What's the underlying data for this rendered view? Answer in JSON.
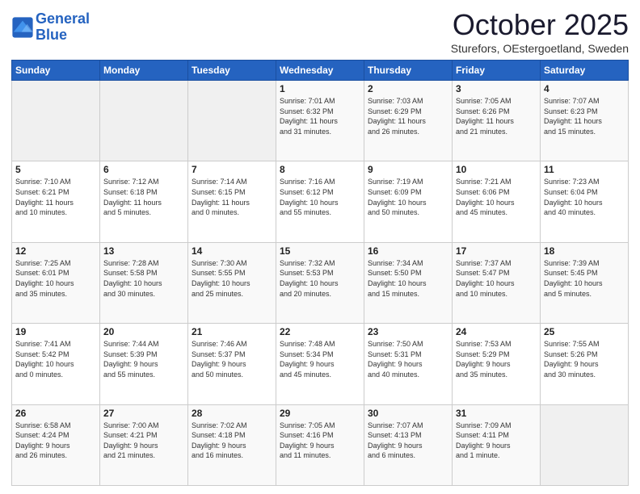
{
  "logo": {
    "line1": "General",
    "line2": "Blue"
  },
  "title": "October 2025",
  "subtitle": "Sturefors, OEstergoetland, Sweden",
  "headers": [
    "Sunday",
    "Monday",
    "Tuesday",
    "Wednesday",
    "Thursday",
    "Friday",
    "Saturday"
  ],
  "weeks": [
    [
      {
        "day": "",
        "info": ""
      },
      {
        "day": "",
        "info": ""
      },
      {
        "day": "",
        "info": ""
      },
      {
        "day": "1",
        "info": "Sunrise: 7:01 AM\nSunset: 6:32 PM\nDaylight: 11 hours\nand 31 minutes."
      },
      {
        "day": "2",
        "info": "Sunrise: 7:03 AM\nSunset: 6:29 PM\nDaylight: 11 hours\nand 26 minutes."
      },
      {
        "day": "3",
        "info": "Sunrise: 7:05 AM\nSunset: 6:26 PM\nDaylight: 11 hours\nand 21 minutes."
      },
      {
        "day": "4",
        "info": "Sunrise: 7:07 AM\nSunset: 6:23 PM\nDaylight: 11 hours\nand 15 minutes."
      }
    ],
    [
      {
        "day": "5",
        "info": "Sunrise: 7:10 AM\nSunset: 6:21 PM\nDaylight: 11 hours\nand 10 minutes."
      },
      {
        "day": "6",
        "info": "Sunrise: 7:12 AM\nSunset: 6:18 PM\nDaylight: 11 hours\nand 5 minutes."
      },
      {
        "day": "7",
        "info": "Sunrise: 7:14 AM\nSunset: 6:15 PM\nDaylight: 11 hours\nand 0 minutes."
      },
      {
        "day": "8",
        "info": "Sunrise: 7:16 AM\nSunset: 6:12 PM\nDaylight: 10 hours\nand 55 minutes."
      },
      {
        "day": "9",
        "info": "Sunrise: 7:19 AM\nSunset: 6:09 PM\nDaylight: 10 hours\nand 50 minutes."
      },
      {
        "day": "10",
        "info": "Sunrise: 7:21 AM\nSunset: 6:06 PM\nDaylight: 10 hours\nand 45 minutes."
      },
      {
        "day": "11",
        "info": "Sunrise: 7:23 AM\nSunset: 6:04 PM\nDaylight: 10 hours\nand 40 minutes."
      }
    ],
    [
      {
        "day": "12",
        "info": "Sunrise: 7:25 AM\nSunset: 6:01 PM\nDaylight: 10 hours\nand 35 minutes."
      },
      {
        "day": "13",
        "info": "Sunrise: 7:28 AM\nSunset: 5:58 PM\nDaylight: 10 hours\nand 30 minutes."
      },
      {
        "day": "14",
        "info": "Sunrise: 7:30 AM\nSunset: 5:55 PM\nDaylight: 10 hours\nand 25 minutes."
      },
      {
        "day": "15",
        "info": "Sunrise: 7:32 AM\nSunset: 5:53 PM\nDaylight: 10 hours\nand 20 minutes."
      },
      {
        "day": "16",
        "info": "Sunrise: 7:34 AM\nSunset: 5:50 PM\nDaylight: 10 hours\nand 15 minutes."
      },
      {
        "day": "17",
        "info": "Sunrise: 7:37 AM\nSunset: 5:47 PM\nDaylight: 10 hours\nand 10 minutes."
      },
      {
        "day": "18",
        "info": "Sunrise: 7:39 AM\nSunset: 5:45 PM\nDaylight: 10 hours\nand 5 minutes."
      }
    ],
    [
      {
        "day": "19",
        "info": "Sunrise: 7:41 AM\nSunset: 5:42 PM\nDaylight: 10 hours\nand 0 minutes."
      },
      {
        "day": "20",
        "info": "Sunrise: 7:44 AM\nSunset: 5:39 PM\nDaylight: 9 hours\nand 55 minutes."
      },
      {
        "day": "21",
        "info": "Sunrise: 7:46 AM\nSunset: 5:37 PM\nDaylight: 9 hours\nand 50 minutes."
      },
      {
        "day": "22",
        "info": "Sunrise: 7:48 AM\nSunset: 5:34 PM\nDaylight: 9 hours\nand 45 minutes."
      },
      {
        "day": "23",
        "info": "Sunrise: 7:50 AM\nSunset: 5:31 PM\nDaylight: 9 hours\nand 40 minutes."
      },
      {
        "day": "24",
        "info": "Sunrise: 7:53 AM\nSunset: 5:29 PM\nDaylight: 9 hours\nand 35 minutes."
      },
      {
        "day": "25",
        "info": "Sunrise: 7:55 AM\nSunset: 5:26 PM\nDaylight: 9 hours\nand 30 minutes."
      }
    ],
    [
      {
        "day": "26",
        "info": "Sunrise: 6:58 AM\nSunset: 4:24 PM\nDaylight: 9 hours\nand 26 minutes."
      },
      {
        "day": "27",
        "info": "Sunrise: 7:00 AM\nSunset: 4:21 PM\nDaylight: 9 hours\nand 21 minutes."
      },
      {
        "day": "28",
        "info": "Sunrise: 7:02 AM\nSunset: 4:18 PM\nDaylight: 9 hours\nand 16 minutes."
      },
      {
        "day": "29",
        "info": "Sunrise: 7:05 AM\nSunset: 4:16 PM\nDaylight: 9 hours\nand 11 minutes."
      },
      {
        "day": "30",
        "info": "Sunrise: 7:07 AM\nSunset: 4:13 PM\nDaylight: 9 hours\nand 6 minutes."
      },
      {
        "day": "31",
        "info": "Sunrise: 7:09 AM\nSunset: 4:11 PM\nDaylight: 9 hours\nand 1 minute."
      },
      {
        "day": "",
        "info": ""
      }
    ]
  ]
}
